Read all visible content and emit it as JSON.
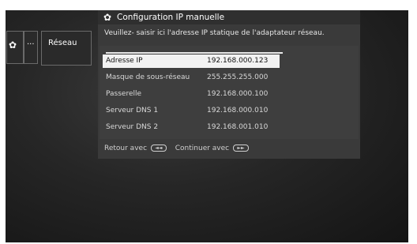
{
  "sidebar": {
    "gear_icon": "gear-icon",
    "dots_label": "...",
    "section_label": "Réseau"
  },
  "dialog": {
    "title": "Configuration IP manuelle",
    "description": "Veuillez- saisir ici l'adresse IP statique de l'adaptateur réseau.",
    "rows": [
      {
        "label": "Adresse IP",
        "value": "192.168.000.123"
      },
      {
        "label": "Masque de sous-réseau",
        "value": "255.255.255.000"
      },
      {
        "label": "Passerelle",
        "value": "192.168.000.100"
      },
      {
        "label": "Serveur DNS 1",
        "value": "192.168.000.010"
      },
      {
        "label": "Serveur DNS 2",
        "value": "192.168.001.010"
      }
    ],
    "footer": {
      "back_label": "Retour avec",
      "back_icon": "◄◄",
      "continue_label": "Continuer avec",
      "continue_icon": "►►"
    }
  },
  "colors": {
    "selected_row_bg": "#f2f2f2",
    "panel_bg": "#3a3a3a"
  }
}
